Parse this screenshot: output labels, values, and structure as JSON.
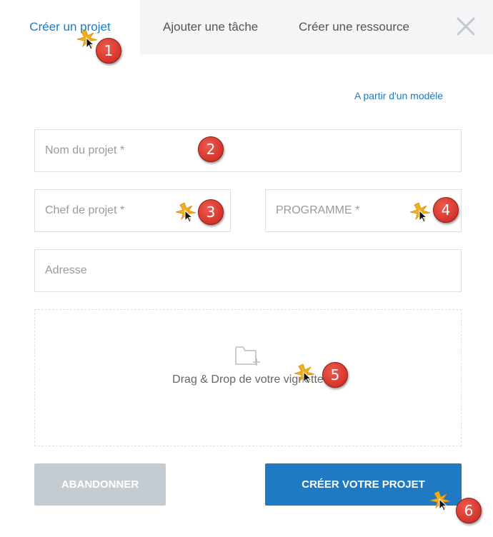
{
  "tabs": [
    {
      "label": "Créer un projet",
      "active": true
    },
    {
      "label": "Ajouter une tâche",
      "active": false
    },
    {
      "label": "Créer une ressource",
      "active": false
    }
  ],
  "close_icon": "close-icon",
  "template_link": "A partir d'un modèle",
  "fields": {
    "project_name": {
      "placeholder": "Nom du projet *",
      "value": ""
    },
    "project_manager": {
      "placeholder": "Chef de projet *",
      "value": ""
    },
    "program": {
      "placeholder": "PROGRAMME *",
      "value": ""
    },
    "address": {
      "placeholder": "Adresse",
      "value": ""
    }
  },
  "dropzone": {
    "icon": "folder-add-icon",
    "text": "Drag & Drop de votre vignette"
  },
  "buttons": {
    "cancel": "ABANDONNER",
    "create": "CRÉER VOTRE PROJET"
  },
  "badges": [
    "1",
    "2",
    "3",
    "4",
    "5",
    "6"
  ],
  "colors": {
    "accent": "#1e7bc0",
    "primary_button": "#2079c3",
    "disabled_button": "#c5ccd1",
    "badge": "#d9332b"
  }
}
